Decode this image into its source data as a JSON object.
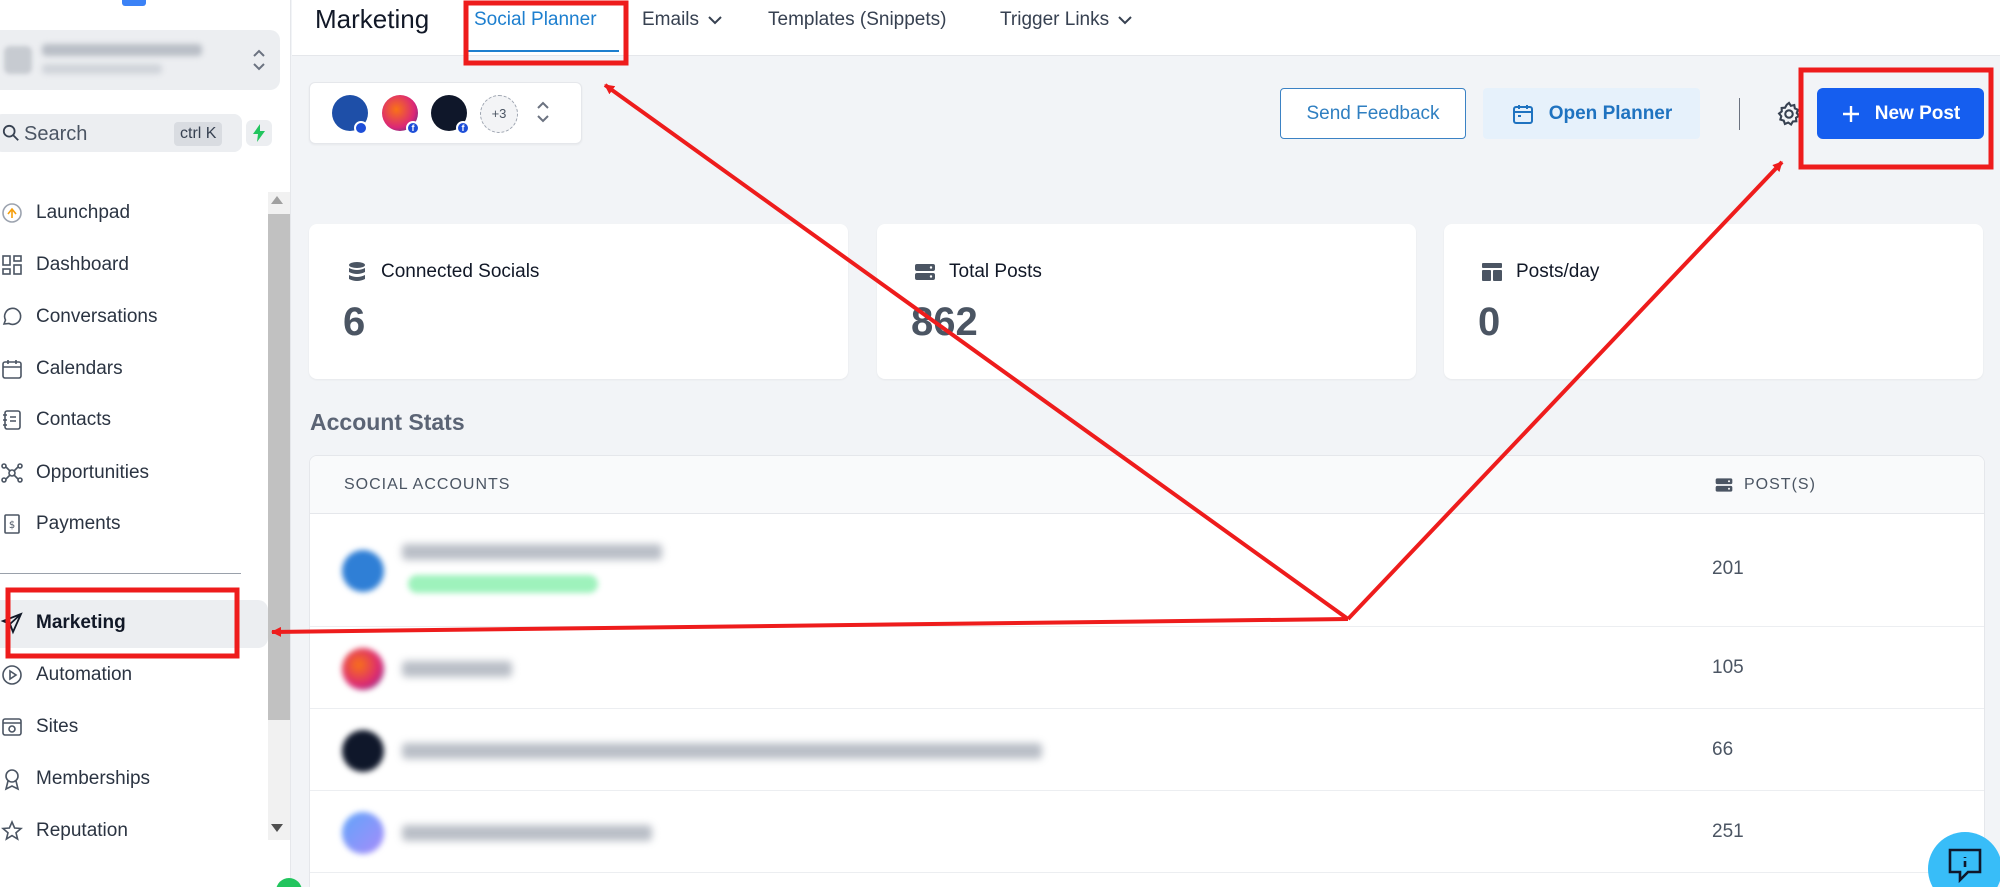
{
  "sidebar": {
    "search_label": "Search",
    "search_shortcut": "ctrl K",
    "items": [
      {
        "label": "Launchpad",
        "icon": "launchpad-icon"
      },
      {
        "label": "Dashboard",
        "icon": "dashboard-icon"
      },
      {
        "label": "Conversations",
        "icon": "conversations-icon"
      },
      {
        "label": "Calendars",
        "icon": "calendar-icon"
      },
      {
        "label": "Contacts",
        "icon": "contacts-icon"
      },
      {
        "label": "Opportunities",
        "icon": "opportunities-icon"
      },
      {
        "label": "Payments",
        "icon": "payments-icon"
      },
      {
        "label": "Marketing",
        "icon": "send-icon",
        "active": true
      },
      {
        "label": "Automation",
        "icon": "automation-icon"
      },
      {
        "label": "Sites",
        "icon": "sites-icon"
      },
      {
        "label": "Memberships",
        "icon": "memberships-icon"
      },
      {
        "label": "Reputation",
        "icon": "star-icon"
      }
    ]
  },
  "topbar": {
    "title": "Marketing",
    "tabs": [
      {
        "label": "Social Planner",
        "active": true
      },
      {
        "label": "Emails",
        "dropdown": true
      },
      {
        "label": "Templates (Snippets)"
      },
      {
        "label": "Trigger Links",
        "dropdown": true
      }
    ]
  },
  "accounts": {
    "more_count": "+3"
  },
  "actions": {
    "send_feedback": "Send Feedback",
    "open_planner": "Open Planner",
    "new_post": "New Post"
  },
  "stats": [
    {
      "label": "Connected Socials",
      "value": "6",
      "icon": "database-icon"
    },
    {
      "label": "Total Posts",
      "value": "862",
      "icon": "server-icon"
    },
    {
      "label": "Posts/day",
      "value": "0",
      "icon": "layout-icon"
    }
  ],
  "account_stats": {
    "title": "Account Stats",
    "col_social": "SOCIAL ACCOUNTS",
    "col_posts": "POST(S)",
    "rows": [
      {
        "posts": "201"
      },
      {
        "posts": "105"
      },
      {
        "posts": "66"
      },
      {
        "posts": "251"
      }
    ]
  },
  "colors": {
    "accent": "#155eef",
    "tab_active": "#1d7fcf",
    "annotation": "#ee1c1c"
  }
}
